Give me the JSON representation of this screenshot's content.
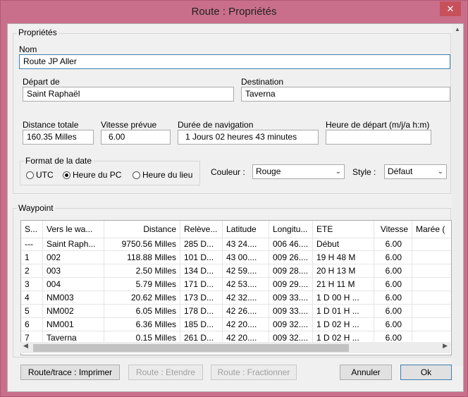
{
  "window": {
    "title": "Route : Propriétés",
    "close": "✕"
  },
  "props": {
    "group_label": "Propriétés",
    "name_label": "Nom",
    "name_value": "Route JP Aller",
    "depart_label": "Départ de",
    "depart_value": "Saint Raphaël",
    "dest_label": "Destination",
    "dest_value": "Taverna",
    "distance_label": "Distance totale",
    "distance_value": "160.35 Milles",
    "speed_label": "Vitesse prévue",
    "speed_value": "6.00",
    "duration_label": "Durée de navigation",
    "duration_value": "1 Jours  02 heures  43 minutes",
    "start_label": "Heure de départ (m/j/a h:m)",
    "start_value": "",
    "date_format_label": "Format de la date",
    "radio_utc": "UTC",
    "radio_pc": "Heure du PC",
    "radio_local": "Heure du lieu",
    "color_label": "Couleur :",
    "color_value": "Rouge",
    "style_label": "Style :",
    "style_value": "Défaut"
  },
  "waypoint": {
    "group_label": "Waypoint",
    "headers": [
      "S...",
      "Vers le wa...",
      "Distance",
      "Relève...",
      "Latitude",
      "Longitu...",
      "ETE",
      "Vitesse",
      "Marée ("
    ],
    "rows": [
      [
        "---",
        "Saint Raph...",
        "9750.56 Milles",
        "285 D...",
        "43 24....",
        "006 46....",
        "Début",
        "6.00",
        ""
      ],
      [
        "1",
        "002",
        "118.88 Milles",
        "101 D...",
        "43 00....",
        "009 26....",
        "19 H  48 M",
        "6.00",
        ""
      ],
      [
        "2",
        "003",
        "2.50 Milles",
        "134 D...",
        "42 59....",
        "009 28....",
        "20 H  13 M",
        "6.00",
        ""
      ],
      [
        "3",
        "004",
        "5.79 Milles",
        "171 D...",
        "42 53....",
        "009 29....",
        "21 H  11 M",
        "6.00",
        ""
      ],
      [
        "4",
        "NM003",
        "20.62 Milles",
        "173 D...",
        "42 32....",
        "009 33....",
        "1 D  00 H ...",
        "6.00",
        ""
      ],
      [
        "5",
        "NM002",
        "6.05 Milles",
        "178 D...",
        "42 26....",
        "009 33....",
        "1 D  01 H ...",
        "6.00",
        ""
      ],
      [
        "6",
        "NM001",
        "6.36 Milles",
        "185 D...",
        "42 20....",
        "009 32....",
        "1 D  02 H ...",
        "6.00",
        ""
      ],
      [
        "7",
        "Taverna",
        "0.15 Milles",
        "261 D...",
        "42 20....",
        "009 32....",
        "1 D  02 H ...",
        "6.00",
        ""
      ]
    ]
  },
  "buttons": {
    "print": "Route/trace : Imprimer",
    "extend": "Route : Etendre",
    "split": "Route : Fractionner",
    "cancel": "Annuler",
    "ok": "Ok"
  }
}
